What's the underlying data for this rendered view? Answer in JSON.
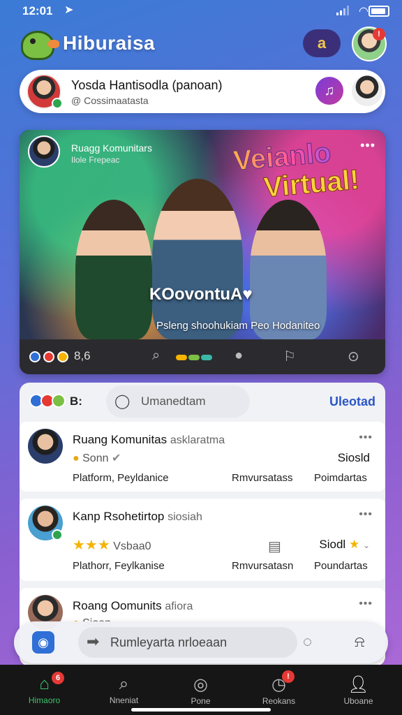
{
  "status": {
    "time": "12:01",
    "location_icon": "location-arrow-icon"
  },
  "header": {
    "app_name": "Hiburaisa",
    "chat_label": "a",
    "notif_count": "!"
  },
  "profile": {
    "name": "Yosda Hantisodla (panoan)",
    "sub": "@ Cossimaatasta"
  },
  "hero": {
    "user_name": "Ruagg Komunitars",
    "user_sub": "Ilole Frepeac",
    "more": "•••",
    "sticker_line1": "Veianlo",
    "sticker_line2": "Virtual!",
    "title": "KOovontuA♥",
    "caption": "Psleng shoohukiam Peo Hodaniteo",
    "reactions_count": "8,6"
  },
  "feed": {
    "tab_label": "B:",
    "search_placeholder": "Umanedtam",
    "upload_label": "Uleotad",
    "posts": [
      {
        "title": "Ruang Komunitas",
        "title_sub": "asklaratma",
        "meta": "Sonn",
        "right": "Siosld",
        "row1": "Platform, Peyldanice",
        "row2": "Rmvursatass",
        "row3": "Poimdartas"
      },
      {
        "title": "Kanp Rsohetirtop",
        "title_sub": "siosiah",
        "meta": "Vsbaa0",
        "right": "Siodl",
        "row1": "Plathorr, Feylkanise",
        "row2": "Rmvursatasn",
        "row3": "Poundartas"
      },
      {
        "title": "Roang Oomunits",
        "title_sub": "afiora",
        "meta": "Sioan",
        "right": "",
        "row1": "",
        "row2": "",
        "row3": ""
      }
    ]
  },
  "composer": {
    "placeholder": "Rumleyarta nrloeaan"
  },
  "tabbar": {
    "items": [
      {
        "label": "Himaoro",
        "icon": "home-icon",
        "badge": "6"
      },
      {
        "label": "Nneniat",
        "icon": "search-icon"
      },
      {
        "label": "Pone",
        "icon": "explore-icon"
      },
      {
        "label": "Reokans",
        "icon": "activity-icon",
        "badge": "!"
      },
      {
        "label": "Uboane",
        "icon": "profile-icon"
      }
    ]
  },
  "colors": {
    "accent": "#3bc46a",
    "link": "#2a56c6",
    "badge": "#e53935"
  }
}
